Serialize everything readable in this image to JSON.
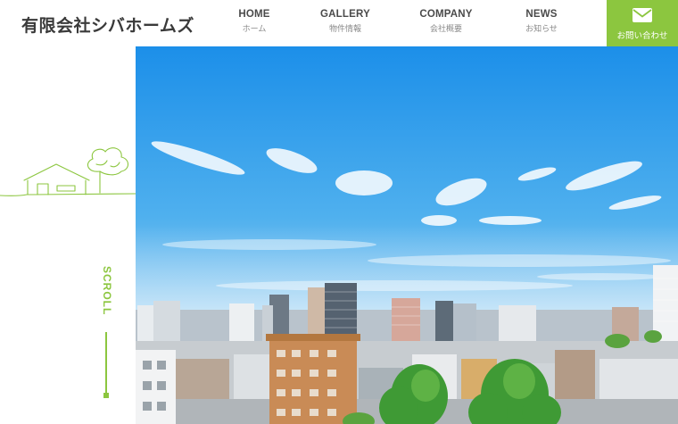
{
  "header": {
    "logo_text": "有限会社シバホームズ",
    "nav": [
      {
        "en": "HOME",
        "ja": "ホーム"
      },
      {
        "en": "GALLERY",
        "ja": "物件情報"
      },
      {
        "en": "COMPANY",
        "ja": "会社概要"
      },
      {
        "en": "NEWS",
        "ja": "お知らせ"
      }
    ],
    "contact": {
      "label": "お問い合わせ",
      "icon": "envelope-icon"
    }
  },
  "side": {
    "scroll_text": "SCROLL",
    "illustration": "house-tree-line-art"
  },
  "hero": {
    "image": "city-skyline-blue-sky-photo"
  },
  "colors": {
    "accent": "#8cc63f",
    "text": "#3a3a3a",
    "sky_top": "#1e8fe8",
    "sky_bottom": "#cde7f7"
  }
}
